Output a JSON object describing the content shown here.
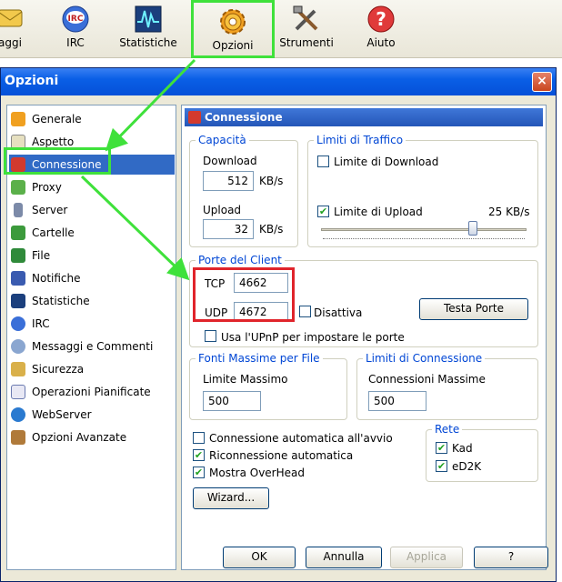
{
  "toolbar": {
    "items": [
      {
        "label": "aggi",
        "icon": "messages-icon"
      },
      {
        "label": "IRC",
        "icon": "irc-icon"
      },
      {
        "label": "Statistiche",
        "icon": "statistics-icon"
      },
      {
        "label": "Opzioni",
        "icon": "gear-icon"
      },
      {
        "label": "Strumenti",
        "icon": "tools-icon"
      },
      {
        "label": "Aiuto",
        "icon": "help-icon"
      }
    ]
  },
  "dialog": {
    "title": "Opzioni",
    "close": "×"
  },
  "nav": {
    "items": [
      {
        "label": "Generale"
      },
      {
        "label": "Aspetto"
      },
      {
        "label": "Connessione"
      },
      {
        "label": "Proxy"
      },
      {
        "label": "Server"
      },
      {
        "label": "Cartelle"
      },
      {
        "label": "File"
      },
      {
        "label": "Notifiche"
      },
      {
        "label": "Statistiche"
      },
      {
        "label": "IRC"
      },
      {
        "label": "Messaggi e Commenti"
      },
      {
        "label": "Sicurezza"
      },
      {
        "label": "Operazioni Pianificate"
      },
      {
        "label": "WebServer"
      },
      {
        "label": "Opzioni Avanzate"
      }
    ],
    "selected": "Connessione"
  },
  "panel": {
    "title": "Connessione",
    "capacita": {
      "title": "Capacità",
      "download_label": "Download",
      "download_value": "512",
      "download_unit": "KB/s",
      "upload_label": "Upload",
      "upload_value": "32",
      "upload_unit": "KB/s"
    },
    "limiti_traffico": {
      "title": "Limiti di Traffico",
      "limite_download": "Limite di Download",
      "limite_download_checked": false,
      "limite_upload": "Limite di Upload",
      "limite_upload_checked": true,
      "upload_limit_value": "25 KB/s",
      "slider_level": 0.75
    },
    "porte": {
      "title": "Porte del Client",
      "tcp_label": "TCP",
      "tcp_value": "4662",
      "udp_label": "UDP",
      "udp_value": "4672",
      "disattiva": "Disattiva",
      "disattiva_checked": false,
      "testa_porte": "Testa Porte",
      "upnp": "Usa l'UPnP per impostare le porte",
      "upnp_checked": false
    },
    "fonti": {
      "title": "Fonti Massime per File",
      "label": "Limite Massimo",
      "value": "500"
    },
    "limiti_connessione": {
      "title": "Limiti di Connessione",
      "label": "Connessioni Massime",
      "value": "500"
    },
    "options": {
      "auto_connect": "Connessione automatica all'avvio",
      "auto_connect_checked": false,
      "reconnect": "Riconnessione automatica",
      "reconnect_checked": true,
      "overhead": "Mostra OverHead",
      "overhead_checked": true
    },
    "rete": {
      "title": "Rete",
      "kad": "Kad",
      "kad_checked": true,
      "ed2k": "eD2K",
      "ed2k_checked": true
    },
    "wizard": "Wizard..."
  },
  "footer": {
    "ok": "OK",
    "annulla": "Annulla",
    "applica": "Applica",
    "help": "?"
  },
  "colors": {
    "highlight_green": "#3fe13b",
    "highlight_red": "#e0242b",
    "selection_blue": "#316ac5"
  }
}
